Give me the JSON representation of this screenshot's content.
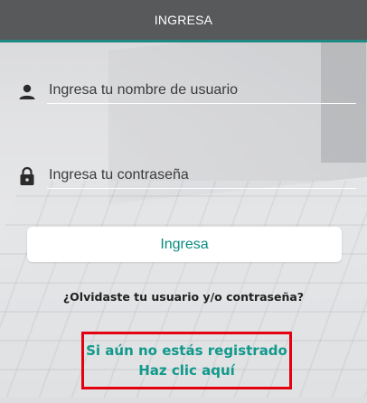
{
  "header": {
    "title": "INGRESA"
  },
  "form": {
    "username": {
      "placeholder": "Ingresa tu nombre de usuario",
      "value": "",
      "icon": "person-icon"
    },
    "password": {
      "placeholder": "Ingresa tu contraseña",
      "value": "",
      "icon": "lock-icon"
    },
    "submit_label": "Ingresa",
    "forgot_label": "¿Olvidaste tu usuario y/o contraseña?",
    "register_line1": "Si aún no estás registrado",
    "register_line2": "Haz clic aquí"
  },
  "colors": {
    "header_bg": "#58595b",
    "accent": "#1f8a84",
    "link_teal": "#11998c",
    "highlight_red": "#e3000f"
  }
}
